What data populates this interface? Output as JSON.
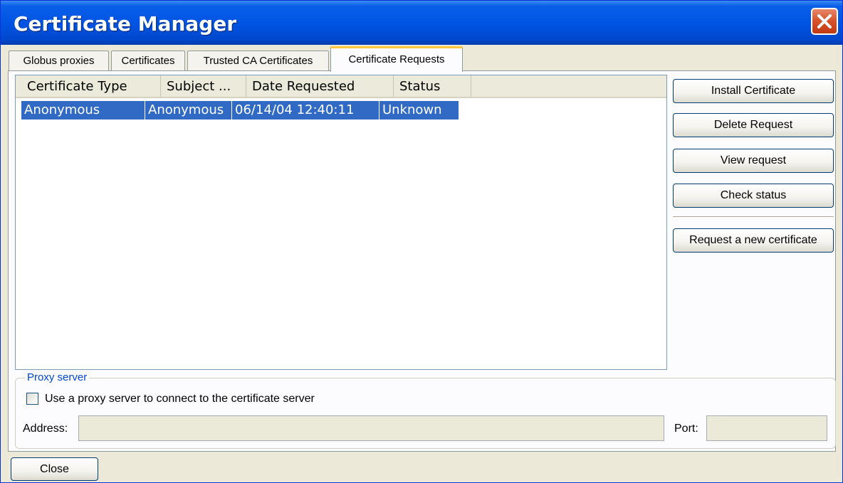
{
  "window": {
    "title": "Certificate Manager",
    "close_icon": "close-icon"
  },
  "tabs": [
    {
      "label": "Globus proxies",
      "active": false
    },
    {
      "label": "Certificates",
      "active": false
    },
    {
      "label": "Trusted CA Certificates",
      "active": false
    },
    {
      "label": "Certificate Requests",
      "active": true
    }
  ],
  "table": {
    "columns": [
      "Certificate Type",
      "Subject ...",
      "Date Requested",
      "Status"
    ],
    "rows": [
      {
        "cells": [
          "Anonymous",
          "Anonymous",
          "06/14/04 12:40:11",
          "Unknown"
        ],
        "selected": true
      }
    ]
  },
  "actions": {
    "install": "Install Certificate",
    "delete": "Delete Request",
    "view": "View request",
    "check": "Check status",
    "request_new": "Request a new certificate"
  },
  "proxy": {
    "group_label": "Proxy server",
    "checkbox_label": "Use a proxy server to connect to the certificate server",
    "checked": false,
    "address_label": "Address:",
    "address_value": "",
    "port_label": "Port:",
    "port_value": ""
  },
  "footer": {
    "close_label": "Close"
  },
  "colors": {
    "titlebar": "#0054e3",
    "selection": "#316ac5",
    "window_bg": "#ece9d8",
    "active_tab_accent": "#ffc83c"
  }
}
